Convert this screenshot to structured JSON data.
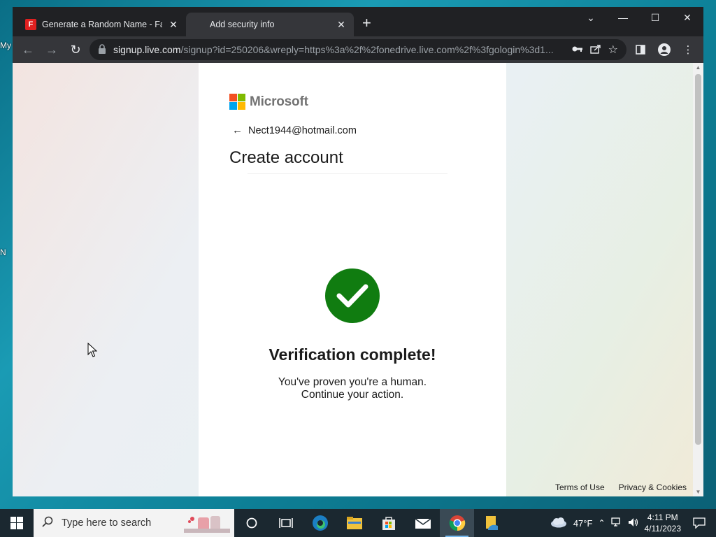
{
  "desktop_fragments": [
    "My",
    "N"
  ],
  "tabs": [
    {
      "title": "Generate a Random Name - Fake",
      "icon": "fakename-f-icon",
      "close": "✕"
    },
    {
      "title": "Add security info",
      "icon": "microsoft-logo-icon",
      "close": "✕"
    }
  ],
  "new_tab": "+",
  "window_controls": {
    "dropdown": "⌄",
    "minimize": "—",
    "maximize": "☐",
    "close": "✕"
  },
  "address_bar": {
    "host": "signup.live.com",
    "path": "/signup?id=250206&wreply=https%3a%2f%2fonedrive.live.com%2f%3fgologin%3d1..."
  },
  "page": {
    "brand": "Microsoft",
    "email": "Nect1944@hotmail.com",
    "title": "Create account",
    "verification_title": "Verification complete!",
    "verification_line1": "You've proven you're a human.",
    "verification_line2": "Continue your action.",
    "footer": {
      "terms": "Terms of Use",
      "privacy": "Privacy & Cookies"
    }
  },
  "colors": {
    "success_green": "#107c10",
    "ms_red": "#f25022",
    "ms_green": "#7fba00",
    "ms_blue": "#00a4ef",
    "ms_yellow": "#ffb900"
  },
  "taskbar": {
    "search_placeholder": "Type here to search",
    "apps": [
      "cortana-icon",
      "task-view-icon",
      "edge-icon",
      "file-explorer-icon",
      "store-icon",
      "mail-icon",
      "chrome-icon",
      "files-app-icon"
    ],
    "weather": "47°F",
    "time": "4:11 PM",
    "date": "4/11/2023"
  }
}
